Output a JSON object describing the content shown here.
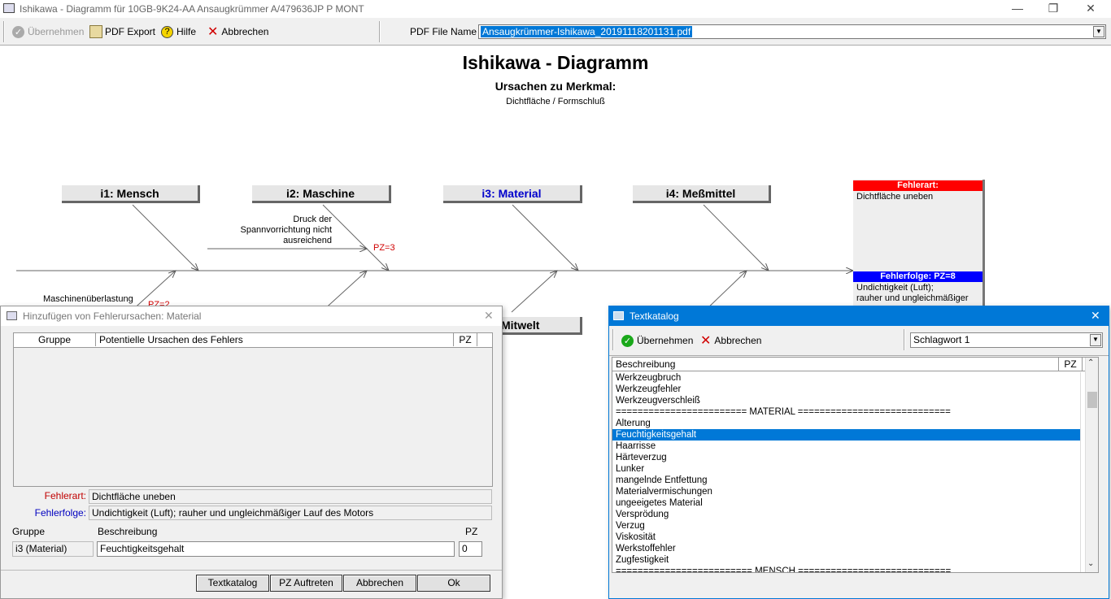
{
  "window": {
    "title": "Ishikawa - Diagramm für 10GB-9K24-AA  Ansaugkrümmer  A/479636JP  P  MONT"
  },
  "toolbar": {
    "uebernehmen": "Übernehmen",
    "pdf_export": "PDF Export",
    "hilfe": "Hilfe",
    "abbrechen": "Abbrechen",
    "pdf_file_label": "PDF File Name",
    "pdf_file_value": "Ansaugkrümmer-Ishikawa_20191118201131.pdf"
  },
  "diagram": {
    "title": "Ishikawa - Diagramm",
    "subtitle": "Ursachen zu Merkmal:",
    "merkmal": "Dichtfläche / Formschluß",
    "categories": {
      "i1": "i1: Mensch",
      "i2": "i2: Maschine",
      "i3": "i3: Material",
      "i4": "i4: Meßmittel",
      "mitwelt": "Mitwelt"
    },
    "causes": {
      "spann_l1": "Druck der",
      "spann_l2": "Spannvorrichtung nicht",
      "spann_l3": "ausreichend",
      "spann_pz": "PZ=3",
      "maschinen": "Maschinenüberlastung",
      "maschinen_pz": "PZ=2"
    },
    "fehlerart_head": "Fehlerart:",
    "fehlerart_text": "Dichtfläche uneben",
    "fehlerfolge_head": "Fehlerfolge: PZ=8",
    "fehlerfolge_l1": "Undichtigkeit (Luft);",
    "fehlerfolge_l2": "rauher und ungleichmäßiger"
  },
  "dialog_add": {
    "title": "Hinzufügen von Fehlerursachen: Material",
    "col_gruppe": "Gruppe",
    "col_ursachen": "Potentielle Ursachen des Fehlers",
    "col_pz": "PZ",
    "fehlerart_label": "Fehlerart:",
    "fehlerart_value": "Dichtfläche uneben",
    "fehlerfolge_label": "Fehlerfolge:",
    "fehlerfolge_value": "Undichtigkeit (Luft); rauher und ungleichmäßiger  Lauf des Motors",
    "gruppe_label": "Gruppe",
    "beschreibung_label": "Beschreibung",
    "pz_label": "PZ",
    "gruppe_value": "i3 (Material)",
    "beschreibung_value": "Feuchtigkeitsgehalt",
    "pz_value": "0",
    "btn_textkatalog": "Textkatalog",
    "btn_pz": "PZ Auftreten",
    "btn_abbrechen": "Abbrechen",
    "btn_ok": "Ok"
  },
  "textkatalog": {
    "title": "Textkatalog",
    "uebernehmen": "Übernehmen",
    "abbrechen": "Abbrechen",
    "schlagwort": "Schlagwort 1",
    "col_beschreibung": "Beschreibung",
    "col_pz": "PZ",
    "items": [
      "Werkzeugbruch",
      "Werkzeugfehler",
      "Werkzeugverschleiß",
      "======================== MATERIAL ============================",
      "Alterung",
      "Feuchtigkeitsgehalt",
      "Haarrisse",
      "Härteverzug",
      "Lunker",
      "mangelnde Entfettung",
      "Materialvermischungen",
      "ungeeigetes Material",
      "Versprödung",
      "Verzug",
      "Viskosität",
      "Werkstoffehler",
      "Zugfestigkeit",
      "========================= MENSCH ============================"
    ],
    "selected_index": 5
  },
  "colors": {
    "accent": "#0078d7",
    "fehlerart": "#ff0000",
    "fehlerfolge": "#0000ff"
  }
}
